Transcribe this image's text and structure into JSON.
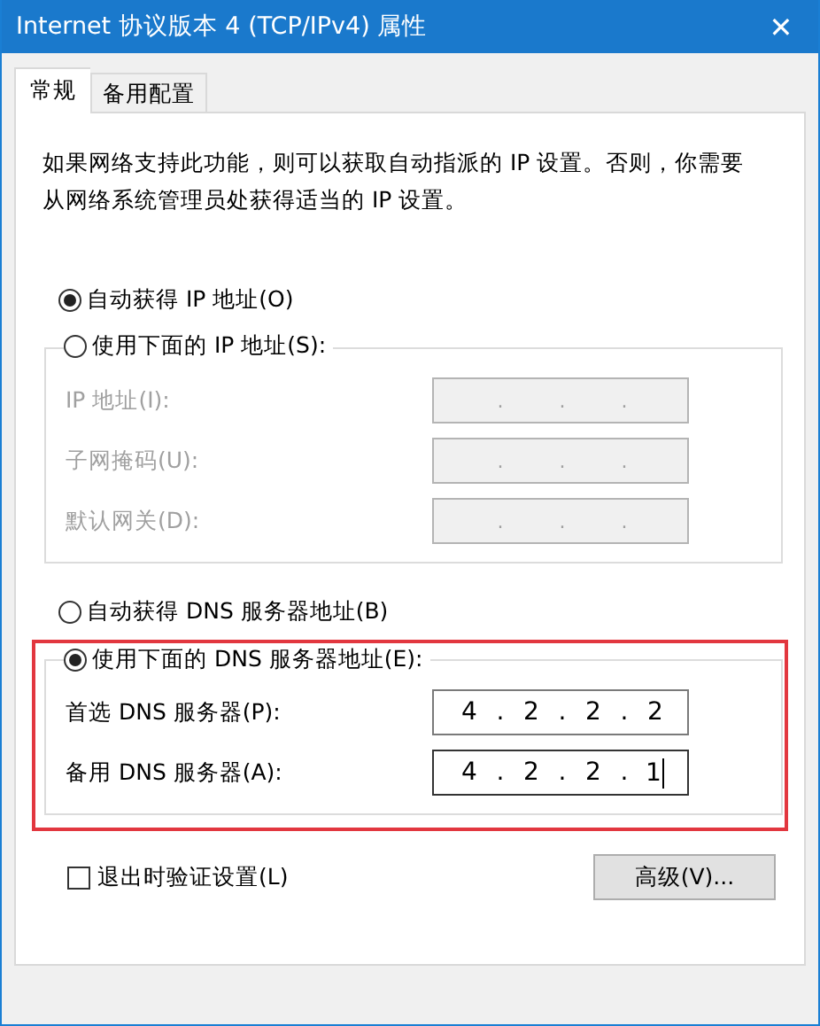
{
  "window": {
    "title": "Internet 协议版本 4 (TCP/IPv4) 属性",
    "close_glyph": "✕"
  },
  "tabs": [
    {
      "label": "常规",
      "selected": true
    },
    {
      "label": "备用配置",
      "selected": false
    }
  ],
  "description": "如果网络支持此功能，则可以获取自动指派的 IP 设置。否则，你需要从网络系统管理员处获得适当的 IP 设置。",
  "ip_auto": {
    "label": "自动获得 IP 地址(O)",
    "selected": true
  },
  "ip_manual": {
    "label": "使用下面的 IP 地址(S):",
    "selected": false,
    "disabled": true,
    "highlight": false,
    "fields": [
      {
        "label": "IP 地址(I):",
        "separator": ".",
        "focused": false
      },
      {
        "label": "子网掩码(U):",
        "separator": ".",
        "focused": false
      },
      {
        "label": "默认网关(D):",
        "separator": ".",
        "focused": false
      }
    ]
  },
  "dns_auto": {
    "label": "自动获得 DNS 服务器地址(B)",
    "selected": false
  },
  "dns_manual": {
    "label": "使用下面的 DNS 服务器地址(E):",
    "selected": true,
    "disabled": false,
    "highlight": true,
    "fields": [
      {
        "label": "首选 DNS 服务器(P):",
        "separator": ".",
        "octets": [
          "4",
          "2",
          "2",
          "2"
        ],
        "focused": false
      },
      {
        "label": "备用 DNS 服务器(A):",
        "separator": ".",
        "octets": [
          "4",
          "2",
          "2",
          "1"
        ],
        "focused": true
      }
    ]
  },
  "validate": {
    "label": "退出时验证设置(L)",
    "checked": false
  },
  "advanced_button": "高级(V)..."
}
